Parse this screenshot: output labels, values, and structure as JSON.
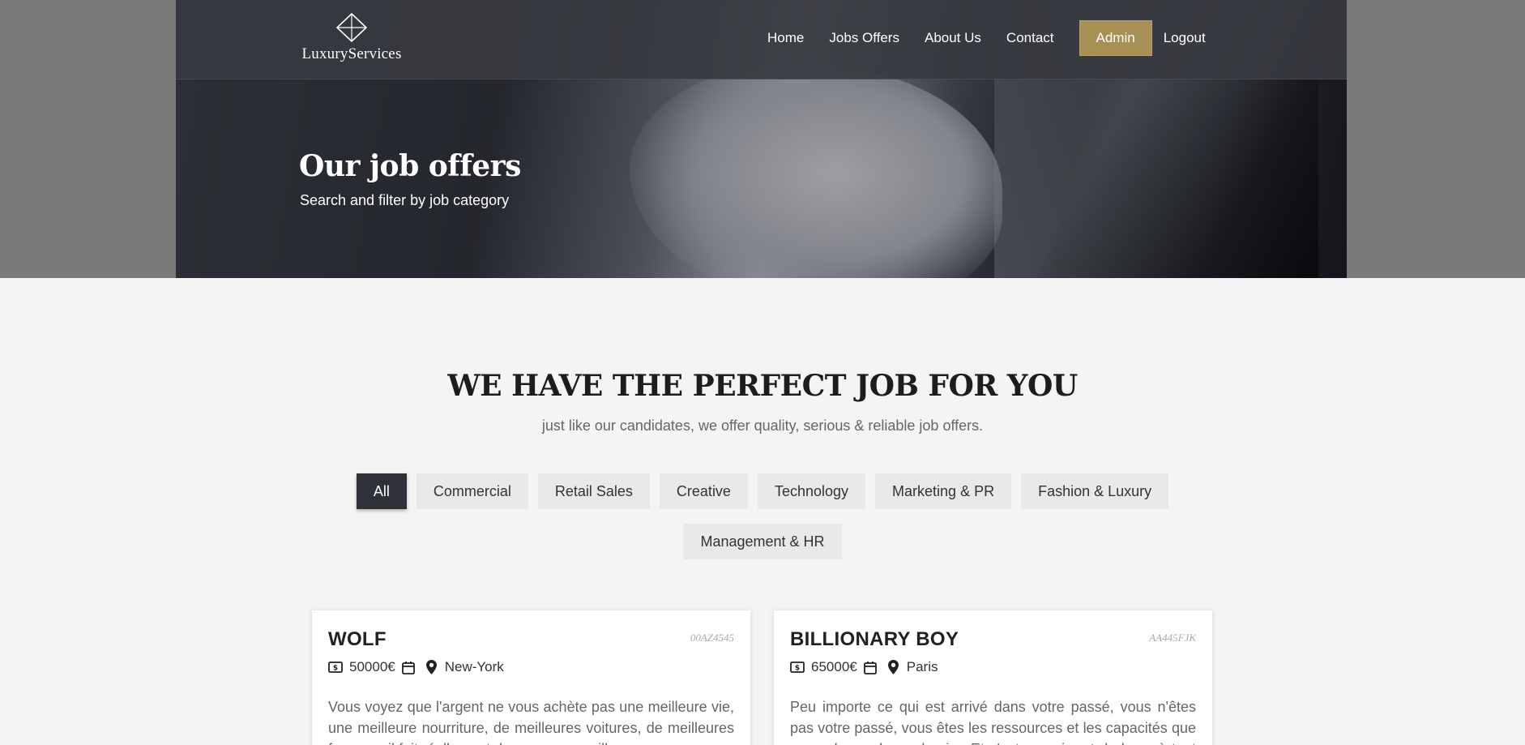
{
  "brand": {
    "name": "LuxuryServices"
  },
  "nav": {
    "items": [
      "Home",
      "Jobs Offers",
      "About Us",
      "Contact"
    ],
    "admin": "Admin",
    "logout": "Logout"
  },
  "hero": {
    "title": "Our job offers",
    "subtitle": "Search and filter by job category"
  },
  "section": {
    "headline": "WE HAVE THE PERFECT JOB FOR YOU",
    "subline": "just like our candidates, we offer quality, serious & reliable job offers."
  },
  "filters": {
    "row1": [
      "All",
      "Commercial",
      "Retail Sales",
      "Creative",
      "Technology",
      "Marketing & PR",
      "Fashion & Luxury"
    ],
    "row2": [
      "Management & HR"
    ],
    "active": "All"
  },
  "jobs": [
    {
      "title": "WOLF",
      "ref": "00AZ4545",
      "salary": "50000€",
      "location": "New-York",
      "description": "Vous voyez que l'argent ne vous achète pas une meilleure vie, une meilleure nourriture, de meilleures voitures, de meilleures femmes, il fait réellement de vous une meilleure personne."
    },
    {
      "title": "BILLIONARY BOY",
      "ref": "AA445FJK",
      "salary": "65000€",
      "location": "Paris",
      "description": "Peu importe ce qui est arrivé dans votre passé, vous n'êtes pas votre passé, vous êtes les ressources et les capacités que vous glanez de ce dernier. Et c'est ce qui sert de base à tout changement."
    }
  ],
  "colors": {
    "accent": "#a88f55",
    "dark": "#2f3138",
    "navbar": "#373940",
    "background": "#f4f4f4"
  }
}
